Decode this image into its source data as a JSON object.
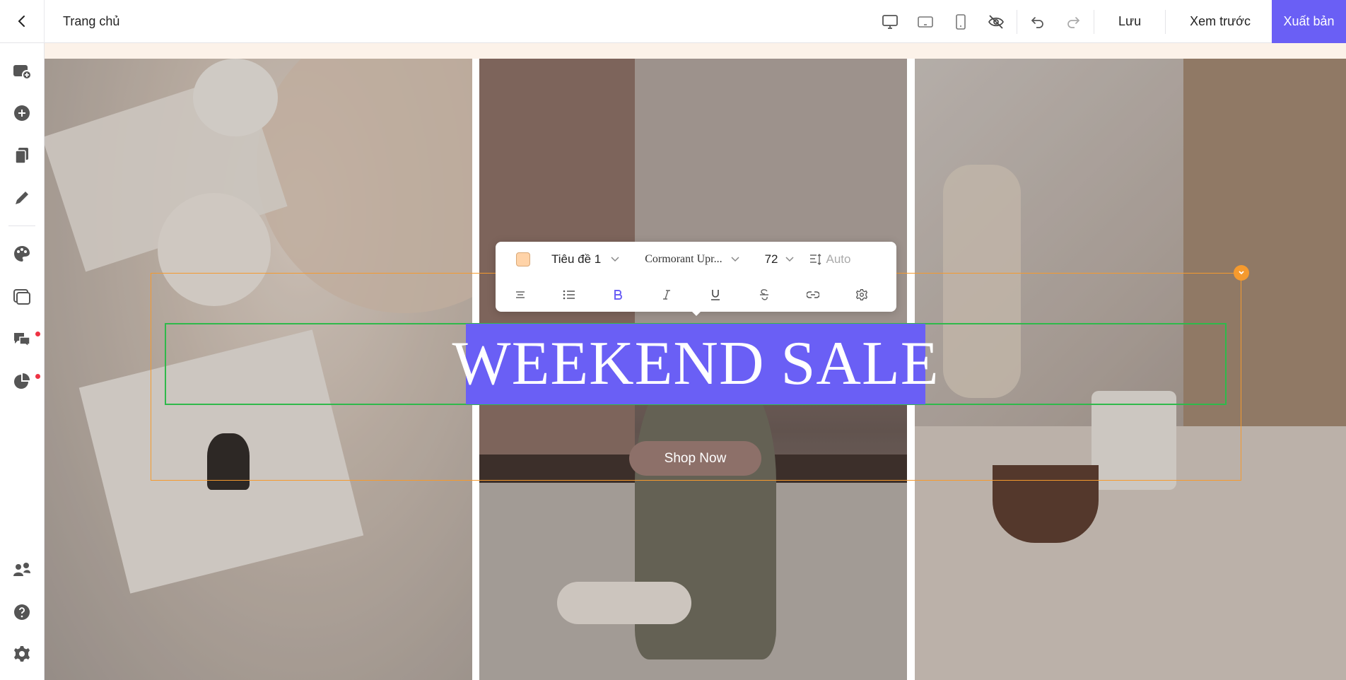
{
  "topbar": {
    "page_name": "Trang chủ",
    "save_label": "Lưu",
    "preview_label": "Xem trước",
    "publish_label": "Xuất bản"
  },
  "sidebar": {
    "items": [
      {
        "icon": "add-section-icon"
      },
      {
        "icon": "add-element-icon"
      },
      {
        "icon": "pages-icon"
      },
      {
        "icon": "pen-icon"
      },
      {
        "icon": "palette-icon"
      },
      {
        "icon": "popup-icon"
      },
      {
        "icon": "chat-icon",
        "notification": true
      },
      {
        "icon": "analytics-icon",
        "notification": true
      },
      {
        "icon": "integrations-icon"
      },
      {
        "icon": "help-icon"
      },
      {
        "icon": "settings-icon"
      }
    ]
  },
  "toolbar": {
    "text_color": "#ffd3a8",
    "style_select": "Tiêu đề 1",
    "font_select": "Cormorant Upr...",
    "size_select": "72",
    "line_height": "Auto"
  },
  "canvas": {
    "headline": "WEEKEND SALE",
    "cta_label": "Shop Now"
  },
  "colors": {
    "accent": "#6a5ff5",
    "selection_outer": "#f59a2e",
    "selection_inner": "#2fb94b",
    "cta_bg": "#8d7069"
  }
}
